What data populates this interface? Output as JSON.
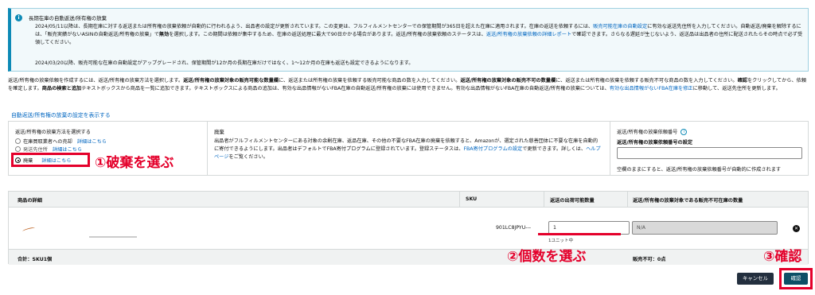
{
  "notice": {
    "title": "長期在庫の自動返送/所有権の放棄",
    "body_1": "2024/05/11以降は、長期在庫に対する返送または所有権の放棄依頼が自動的に行われるよう、出品者の設定が更新されています。この変更は、フルフィルメントセンターでの保管期間が365日を超えた在庫に適用されます。在庫の返送を依頼するには、",
    "body_link_1": "販売可能在庫の自動設定",
    "body_2": "に有効な返送先住所を入力してください。自動返送/廃棄を解除するには、「販売実績がないASINの自動返送/所有権の放棄」で",
    "body_bold_1": "無効",
    "body_3": "を選択します。この期間は依頼が集中するため、在庫の返送処理に最大で90日かかる場合があります。返送/所有権の放棄依頼のステータスは、",
    "body_link_2": "返送/所有権の放棄依頼の詳細レポート",
    "body_4": "で確認できます。さらなる遅延が生じないよう、返送品は出品者の住所に配送されたらその時点で必ず受領してください。",
    "update_2024": "2024/03/20以降、販売可能な在庫の自動設定がアップグレードされ、保管期間が12か月の長期在庫だけではなく、1〜12か月の在庫も返送も設定できるようになります。"
  },
  "description": {
    "p1": "返送/所有権の放棄依頼を作成するには、返送/所有権の放棄方法を選択します。",
    "b1": "返送/所有権の放棄対象の販売可能な数量欄",
    "p2": "に、返送または所有権の放棄を依頼する販売可能な商品の数を入力してください。",
    "b2": "返送/所有権の放棄対象の販売不可の数量欄",
    "p3": "に、返送または所有権の放棄を依頼する販売不可な商品の数を入力してください。",
    "b3": "確認",
    "p4": "をクリックしてから、依頼を確定します。",
    "b4": "商品の検索と追加",
    "p5": "テキストボックスから商品を一覧に追加できます。テキストボックスによる商品の追加は、有効な出品情報がないFBA在庫の自動返送/所有権の放棄には使用できません。有効な出品情報がないFBA在庫の自動返送/所有権の放棄については、",
    "link": "有効な出品情報がないFBA在庫を修正",
    "p6": "に移動して、返送先住所を更新します。"
  },
  "show_settings_link": "自動返送/所有権の放棄の設定を表示する",
  "method": {
    "title": "返送/所有権の放棄方法を選択する",
    "options": [
      {
        "label": "在庫買取業者への売却",
        "detail": "詳細はこちら"
      },
      {
        "label": "発送先住所",
        "detail": "詳細はこちら"
      },
      {
        "label": "廃棄",
        "detail": "詳細はこちら"
      }
    ]
  },
  "disposal": {
    "title": "廃棄",
    "body_1": "出品者がフルフィルメントセンターにある対象の余剰在庫、返品在庫、その他の不要なFBA在庫の廃棄を依頼すると、Amazonが、選定された慈善団体に不要な在庫を自動的に寄付できるようにします。出品者はデフォルトでFBA寄付プログラムに登録されています。登録ステータスは、",
    "link_1": "FBA寄付プログラムの設定",
    "body_2": "で更新できます。詳しくは、",
    "link_2": "ヘルプページ",
    "body_3": "をご覧ください。"
  },
  "request_id": {
    "title": "返送/所有権の放棄依頼番号",
    "label": "返送/所有権の放棄依頼番号の設定",
    "value": "",
    "note": "空欄のままにすると、返送/所有権の放棄依頼番号が自動的に作成されます"
  },
  "table": {
    "headers": {
      "product": "商品の詳細",
      "sku": "SKU",
      "sellable_qty": "返送の出荷可能数量",
      "unsellable_qty": "返送/所有権の放棄対象である販売不可在庫の数量"
    },
    "rows": [
      {
        "sku": "901LC8JPYU---",
        "quantity": "1",
        "quantity_hint": "1ユニット中",
        "unsellable": "N/A"
      }
    ],
    "total": "合計：SKU1個",
    "not_sellable": "販売不可：0点"
  },
  "buttons": {
    "cancel": "キャンセル",
    "confirm": "確認"
  },
  "annotations": {
    "step1": "①破棄を選ぶ",
    "step2": "②個数を選ぶ",
    "step3": "③確認"
  },
  "colors": {
    "annotation_red": "#e4002b",
    "link_blue": "#0066c0",
    "confirm_button": "#0d4f66",
    "cancel_button": "#232f3e"
  },
  "icons": {
    "info": "info-icon",
    "remove": "remove-icon"
  }
}
